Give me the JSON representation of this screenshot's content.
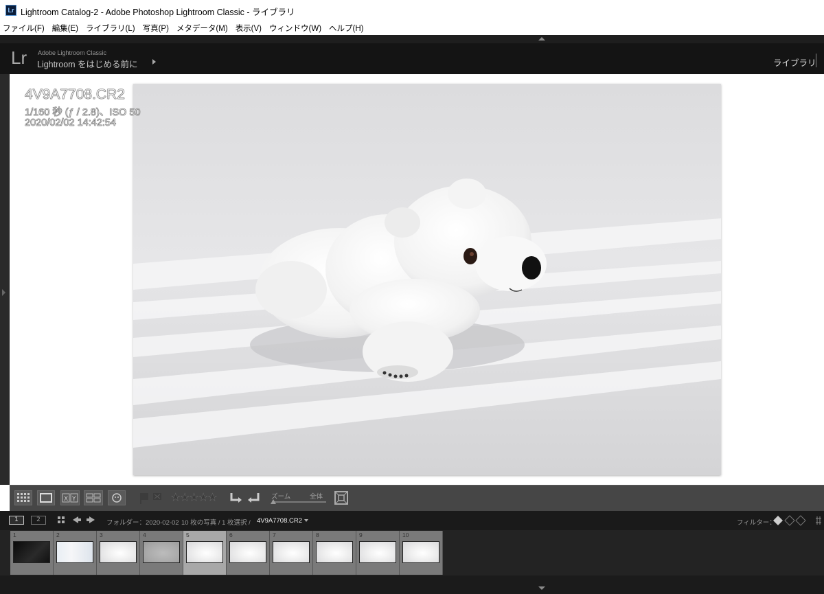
{
  "window": {
    "app_icon": "Lr",
    "title": "Lightroom Catalog-2 - Adobe Photoshop Lightroom Classic - ライブラリ"
  },
  "menu": [
    "ファイル(F)",
    "編集(E)",
    "ライブラリ(L)",
    "写真(P)",
    "メタデータ(M)",
    "表示(V)",
    "ウィンドウ(W)",
    "ヘルプ(H)"
  ],
  "identity": {
    "logo": "Lr",
    "product_small": "Adobe Lightroom Classic",
    "product_main": "Lightroom をはじめる前に",
    "active_module": "ライブラリ"
  },
  "photo_info": {
    "filename": "4V9A7708.CR2",
    "exposure": "1/160 秒 (ƒ / 2.8)、ISO 50",
    "datetime": "2020/02/02 14:42:54"
  },
  "toolbar": {
    "stars": "★★★★★",
    "zoom_label": "ズーム",
    "zoom_value": "全体"
  },
  "filmstrip_header": {
    "screen_1": "1",
    "screen_2": "2",
    "source": "フォルダー：2020-02-02",
    "count": "10 枚の写真 / 1 枚選択 /",
    "selected_file": "4V9A7708.CR2",
    "filter_label": "フィルター："
  },
  "filmstrip": {
    "selected_index": 4,
    "thumbnails": [
      {
        "num": "1",
        "tone": "dark"
      },
      {
        "num": "2",
        "tone": "room"
      },
      {
        "num": "3",
        "tone": "light"
      },
      {
        "num": "4",
        "tone": "grey"
      },
      {
        "num": "5",
        "tone": "light"
      },
      {
        "num": "6",
        "tone": "light"
      },
      {
        "num": "7",
        "tone": "light"
      },
      {
        "num": "8",
        "tone": "light"
      },
      {
        "num": "9",
        "tone": "light"
      },
      {
        "num": "10",
        "tone": "light"
      }
    ]
  },
  "colors": {
    "panel_dark": "#141414",
    "toolbar": "#464646",
    "filmstrip_cell": "#7a7a7a",
    "filmstrip_selected": "#a8a8a8"
  }
}
